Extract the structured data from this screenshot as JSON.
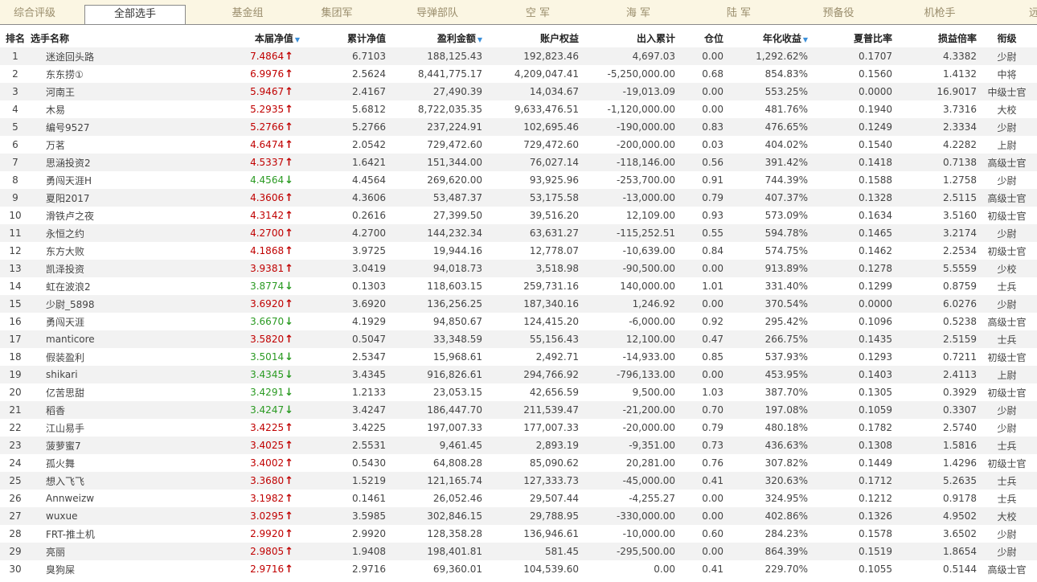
{
  "tabs": [
    "综合评级",
    "全部选手",
    "基金组",
    "集团军",
    "导弹部队",
    "空 军",
    "海 军",
    "陆 军",
    "预备役",
    "机枪手",
    "远征"
  ],
  "active_tab": 1,
  "columns": [
    {
      "label": "排名",
      "sort": false
    },
    {
      "label": "选手名称",
      "sort": false
    },
    {
      "label": "本届净值",
      "sort": true
    },
    {
      "label": "累计净值",
      "sort": false
    },
    {
      "label": "盈利金额",
      "sort": true
    },
    {
      "label": "账户权益",
      "sort": false
    },
    {
      "label": "出入累计",
      "sort": false
    },
    {
      "label": "仓位",
      "sort": false
    },
    {
      "label": "年化收益",
      "sort": true
    },
    {
      "label": "夏普比率",
      "sort": false
    },
    {
      "label": "损益倍率",
      "sort": false
    },
    {
      "label": "衔级",
      "sort": false
    }
  ],
  "colors": {
    "up": "#c00000",
    "down": "#2a9a22",
    "sort_icon": "#3b8fd9"
  },
  "rows": [
    {
      "rank": "1",
      "name": "迷途回头路",
      "nav": "7.4864",
      "dir": "up",
      "cum": "6.7103",
      "profit": "188,125.43",
      "equity": "192,823.46",
      "flow": "4,697.03",
      "pos": "0.00",
      "annual": "1,292.62%",
      "sharpe": "0.1707",
      "pl": "4.3382",
      "grade": "少尉"
    },
    {
      "rank": "2",
      "name": "东东捞①",
      "nav": "6.9976",
      "dir": "up",
      "cum": "2.5624",
      "profit": "8,441,775.17",
      "equity": "4,209,047.41",
      "flow": "-5,250,000.00",
      "pos": "0.68",
      "annual": "854.83%",
      "sharpe": "0.1560",
      "pl": "1.4132",
      "grade": "中将"
    },
    {
      "rank": "3",
      "name": "河南王",
      "nav": "5.9467",
      "dir": "up",
      "cum": "2.4167",
      "profit": "27,490.39",
      "equity": "14,034.67",
      "flow": "-19,013.09",
      "pos": "0.00",
      "annual": "553.25%",
      "sharpe": "0.0000",
      "pl": "16.9017",
      "grade": "中级士官"
    },
    {
      "rank": "4",
      "name": "木易",
      "nav": "5.2935",
      "dir": "up",
      "cum": "5.6812",
      "profit": "8,722,035.35",
      "equity": "9,633,476.51",
      "flow": "-1,120,000.00",
      "pos": "0.00",
      "annual": "481.76%",
      "sharpe": "0.1940",
      "pl": "3.7316",
      "grade": "大校"
    },
    {
      "rank": "5",
      "name": "编号9527",
      "nav": "5.2766",
      "dir": "up",
      "cum": "5.2766",
      "profit": "237,224.91",
      "equity": "102,695.46",
      "flow": "-190,000.00",
      "pos": "0.83",
      "annual": "476.65%",
      "sharpe": "0.1249",
      "pl": "2.3334",
      "grade": "少尉"
    },
    {
      "rank": "6",
      "name": "万茗",
      "nav": "4.6474",
      "dir": "up",
      "cum": "2.0542",
      "profit": "729,472.60",
      "equity": "729,472.60",
      "flow": "-200,000.00",
      "pos": "0.03",
      "annual": "404.02%",
      "sharpe": "0.1540",
      "pl": "4.2282",
      "grade": "上尉"
    },
    {
      "rank": "7",
      "name": "思涵投资2",
      "nav": "4.5337",
      "dir": "up",
      "cum": "1.6421",
      "profit": "151,344.00",
      "equity": "76,027.14",
      "flow": "-118,146.00",
      "pos": "0.56",
      "annual": "391.42%",
      "sharpe": "0.1418",
      "pl": "0.7138",
      "grade": "高级士官"
    },
    {
      "rank": "8",
      "name": "勇闯天涯H",
      "nav": "4.4564",
      "dir": "down",
      "cum": "4.4564",
      "profit": "269,620.00",
      "equity": "93,925.96",
      "flow": "-253,700.00",
      "pos": "0.91",
      "annual": "744.39%",
      "sharpe": "0.1588",
      "pl": "1.2758",
      "grade": "少尉"
    },
    {
      "rank": "9",
      "name": "夏阳2017",
      "nav": "4.3606",
      "dir": "up",
      "cum": "4.3606",
      "profit": "53,487.37",
      "equity": "53,175.58",
      "flow": "-13,000.00",
      "pos": "0.79",
      "annual": "407.37%",
      "sharpe": "0.1328",
      "pl": "2.5115",
      "grade": "高级士官"
    },
    {
      "rank": "10",
      "name": "滑铁卢之夜",
      "nav": "4.3142",
      "dir": "up",
      "cum": "0.2616",
      "profit": "27,399.50",
      "equity": "39,516.20",
      "flow": "12,109.00",
      "pos": "0.93",
      "annual": "573.09%",
      "sharpe": "0.1634",
      "pl": "3.5160",
      "grade": "初级士官"
    },
    {
      "rank": "11",
      "name": "永恒之约",
      "nav": "4.2700",
      "dir": "up",
      "cum": "4.2700",
      "profit": "144,232.34",
      "equity": "63,631.27",
      "flow": "-115,252.51",
      "pos": "0.55",
      "annual": "594.78%",
      "sharpe": "0.1465",
      "pl": "3.2174",
      "grade": "少尉"
    },
    {
      "rank": "12",
      "name": "东方大败",
      "nav": "4.1868",
      "dir": "up",
      "cum": "3.9725",
      "profit": "19,944.16",
      "equity": "12,778.07",
      "flow": "-10,639.00",
      "pos": "0.84",
      "annual": "574.75%",
      "sharpe": "0.1462",
      "pl": "2.2534",
      "grade": "初级士官"
    },
    {
      "rank": "13",
      "name": "凯泽投资",
      "nav": "3.9381",
      "dir": "up",
      "cum": "3.0419",
      "profit": "94,018.73",
      "equity": "3,518.98",
      "flow": "-90,500.00",
      "pos": "0.00",
      "annual": "913.89%",
      "sharpe": "0.1278",
      "pl": "5.5559",
      "grade": "少校"
    },
    {
      "rank": "14",
      "name": "虹在波浪2",
      "nav": "3.8774",
      "dir": "down",
      "cum": "0.1303",
      "profit": "118,603.15",
      "equity": "259,731.16",
      "flow": "140,000.00",
      "pos": "1.01",
      "annual": "331.40%",
      "sharpe": "0.1299",
      "pl": "0.8759",
      "grade": "士兵"
    },
    {
      "rank": "15",
      "name": "少尉_5898",
      "nav": "3.6920",
      "dir": "up",
      "cum": "3.6920",
      "profit": "136,256.25",
      "equity": "187,340.16",
      "flow": "1,246.92",
      "pos": "0.00",
      "annual": "370.54%",
      "sharpe": "0.0000",
      "pl": "6.0276",
      "grade": "少尉"
    },
    {
      "rank": "16",
      "name": "勇闯天涯",
      "nav": "3.6670",
      "dir": "down",
      "cum": "4.1929",
      "profit": "94,850.67",
      "equity": "124,415.20",
      "flow": "-6,000.00",
      "pos": "0.92",
      "annual": "295.42%",
      "sharpe": "0.1096",
      "pl": "0.5238",
      "grade": "高级士官"
    },
    {
      "rank": "17",
      "name": "manticore",
      "nav": "3.5820",
      "dir": "up",
      "cum": "0.5047",
      "profit": "33,348.59",
      "equity": "55,156.43",
      "flow": "12,100.00",
      "pos": "0.47",
      "annual": "266.75%",
      "sharpe": "0.1435",
      "pl": "2.5159",
      "grade": "士兵"
    },
    {
      "rank": "18",
      "name": "假装盈利",
      "nav": "3.5014",
      "dir": "down",
      "cum": "2.5347",
      "profit": "15,968.61",
      "equity": "2,492.71",
      "flow": "-14,933.00",
      "pos": "0.85",
      "annual": "537.93%",
      "sharpe": "0.1293",
      "pl": "0.7211",
      "grade": "初级士官"
    },
    {
      "rank": "19",
      "name": "shikari",
      "nav": "3.4345",
      "dir": "down",
      "cum": "3.4345",
      "profit": "916,826.61",
      "equity": "294,766.92",
      "flow": "-796,133.00",
      "pos": "0.00",
      "annual": "453.95%",
      "sharpe": "0.1403",
      "pl": "2.4113",
      "grade": "上尉"
    },
    {
      "rank": "20",
      "name": "亿苦思甜",
      "nav": "3.4291",
      "dir": "down",
      "cum": "1.2133",
      "profit": "23,053.15",
      "equity": "42,656.59",
      "flow": "9,500.00",
      "pos": "1.03",
      "annual": "387.70%",
      "sharpe": "0.1305",
      "pl": "0.3929",
      "grade": "初级士官"
    },
    {
      "rank": "21",
      "name": "稻香",
      "nav": "3.4247",
      "dir": "down",
      "cum": "3.4247",
      "profit": "186,447.70",
      "equity": "211,539.47",
      "flow": "-21,200.00",
      "pos": "0.70",
      "annual": "197.08%",
      "sharpe": "0.1059",
      "pl": "0.3307",
      "grade": "少尉"
    },
    {
      "rank": "22",
      "name": "江山易手",
      "nav": "3.4225",
      "dir": "up",
      "cum": "3.4225",
      "profit": "197,007.33",
      "equity": "177,007.33",
      "flow": "-20,000.00",
      "pos": "0.79",
      "annual": "480.18%",
      "sharpe": "0.1782",
      "pl": "2.5740",
      "grade": "少尉"
    },
    {
      "rank": "23",
      "name": "菠萝蜜7",
      "nav": "3.4025",
      "dir": "up",
      "cum": "2.5531",
      "profit": "9,461.45",
      "equity": "2,893.19",
      "flow": "-9,351.00",
      "pos": "0.73",
      "annual": "436.63%",
      "sharpe": "0.1308",
      "pl": "1.5816",
      "grade": "士兵"
    },
    {
      "rank": "24",
      "name": "孤火舞",
      "nav": "3.4002",
      "dir": "up",
      "cum": "0.5430",
      "profit": "64,808.28",
      "equity": "85,090.62",
      "flow": "20,281.00",
      "pos": "0.76",
      "annual": "307.82%",
      "sharpe": "0.1449",
      "pl": "1.4296",
      "grade": "初级士官"
    },
    {
      "rank": "25",
      "name": "想入飞飞",
      "nav": "3.3680",
      "dir": "up",
      "cum": "1.5219",
      "profit": "121,165.74",
      "equity": "127,333.73",
      "flow": "-45,000.00",
      "pos": "0.41",
      "annual": "320.63%",
      "sharpe": "0.1712",
      "pl": "5.2635",
      "grade": "士兵"
    },
    {
      "rank": "26",
      "name": "Annweizw",
      "nav": "3.1982",
      "dir": "up",
      "cum": "0.1461",
      "profit": "26,052.46",
      "equity": "29,507.44",
      "flow": "-4,255.27",
      "pos": "0.00",
      "annual": "324.95%",
      "sharpe": "0.1212",
      "pl": "0.9178",
      "grade": "士兵"
    },
    {
      "rank": "27",
      "name": "wuxue",
      "nav": "3.0295",
      "dir": "up",
      "cum": "3.5985",
      "profit": "302,846.15",
      "equity": "29,788.95",
      "flow": "-330,000.00",
      "pos": "0.00",
      "annual": "402.86%",
      "sharpe": "0.1326",
      "pl": "4.9502",
      "grade": "大校"
    },
    {
      "rank": "28",
      "name": "FRT-推土机",
      "nav": "2.9920",
      "dir": "up",
      "cum": "2.9920",
      "profit": "128,358.28",
      "equity": "136,946.61",
      "flow": "-10,000.00",
      "pos": "0.60",
      "annual": "284.23%",
      "sharpe": "0.1578",
      "pl": "3.6502",
      "grade": "少尉"
    },
    {
      "rank": "29",
      "name": "亮丽",
      "nav": "2.9805",
      "dir": "up",
      "cum": "1.9408",
      "profit": "198,401.81",
      "equity": "581.45",
      "flow": "-295,500.00",
      "pos": "0.00",
      "annual": "864.39%",
      "sharpe": "0.1519",
      "pl": "1.8654",
      "grade": "少尉"
    },
    {
      "rank": "30",
      "name": "臭狗屎",
      "nav": "2.9716",
      "dir": "up",
      "cum": "2.9716",
      "profit": "69,360.01",
      "equity": "104,539.60",
      "flow": "0.00",
      "pos": "0.41",
      "annual": "229.70%",
      "sharpe": "0.1055",
      "pl": "0.5144",
      "grade": "高级士官"
    }
  ]
}
